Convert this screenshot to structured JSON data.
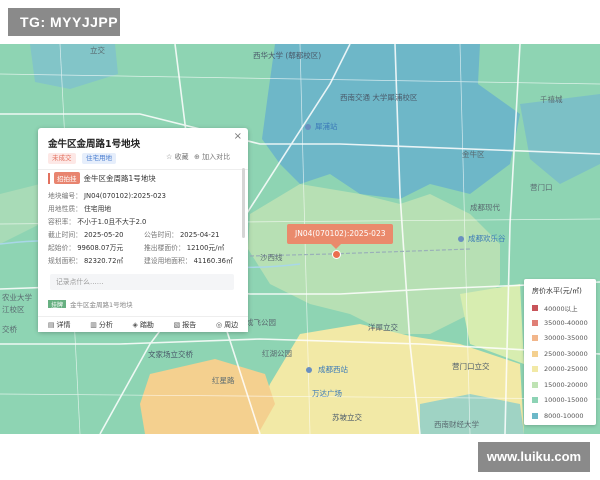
{
  "watermark_top": "TG: MYYJJPP",
  "watermark_bottom": "www.luiku.com",
  "map_labels": {
    "station_north_top": "西华大学\n(郫都校区)",
    "north_center": "西南交通\n大学犀浦校区",
    "xipu_station": "犀浦站",
    "rail_label": "沙西线",
    "top_left_road": "立交",
    "right_top": "千禧城",
    "right_top2": "金牛区",
    "huanqiu": "成都欢乐谷",
    "xiandai": "成都现代",
    "left_mid1": "农业大学",
    "left_mid2": "江校区",
    "left_mid3": "交桥",
    "wenjia": "文家场立交桥",
    "chengdu_west": "成都西站",
    "hongqiao": "红星路",
    "wanda": "万达广场",
    "suzhou": "苏坡立交",
    "yangxi": "洋犀立交",
    "yingmen": "营门口立交",
    "southwest": "西南财经大学",
    "hongqiao2": "红湖公园",
    "right_cluster": "营门口",
    "green_park": "成飞公园"
  },
  "popup": {
    "title": "金牛区金周路1号地块",
    "close": "×",
    "tag_status": "未成交",
    "tag_use": "住宅用地",
    "fav": "☆ 收藏",
    "compare": "⊕ 加入对比",
    "bid_tag": "招拍挂",
    "bid_name": "金牛区金周路1号地块",
    "fields": {
      "parcel_label": "地块编号：",
      "parcel_value": "JN04(070102):2025-023",
      "use_label": "用地性质：",
      "use_value": "住宅用地",
      "far_label": "容积率：",
      "far_value": "不小于1.0且不大于2.0",
      "end_label": "截止时间：",
      "end_value": "2025-05-20",
      "announce_label": "公告时间：",
      "announce_value": "2025-04-21",
      "start_price_label": "起始价：",
      "start_price_value": "99608.07万元",
      "floor_price_label": "推出楼面价：",
      "floor_price_value": "12100元/㎡",
      "area_label": "规划面积：",
      "area_value": "82320.72㎡",
      "build_area_label": "建设用地面积：",
      "build_area_value": "41160.36㎡"
    },
    "note_placeholder": "记录点什么……",
    "second_tag": "挂牌",
    "second_name": "金牛区金周路1号地块",
    "bar": {
      "detail": "详情",
      "analysis": "分析",
      "survey": "踏勘",
      "report": "报告",
      "around": "周边"
    }
  },
  "marker": {
    "label": "JN04(070102):2025-023"
  },
  "legend": {
    "title": "房价水平(元/㎡)",
    "items": [
      {
        "label": "40000以上",
        "color": "#c8545a"
      },
      {
        "label": "35000-40000",
        "color": "#e07f76"
      },
      {
        "label": "30000-35000",
        "color": "#f2b68b"
      },
      {
        "label": "25000-30000",
        "color": "#f4d08f"
      },
      {
        "label": "20000-25000",
        "color": "#f2e9a6"
      },
      {
        "label": "15000-20000",
        "color": "#bfe3b4"
      },
      {
        "label": "10000-15000",
        "color": "#8dd3b5"
      },
      {
        "label": "8000-10000",
        "color": "#6cb8c8"
      }
    ]
  },
  "colors": {
    "blue_zone": "#6eb7c8",
    "green_zone": "#8ed4b3",
    "light_green_zone": "#bfe3b4",
    "yellow_zone": "#f2e9a6",
    "orange_zone": "#f4d08f",
    "accent": "#ea8a6c"
  }
}
